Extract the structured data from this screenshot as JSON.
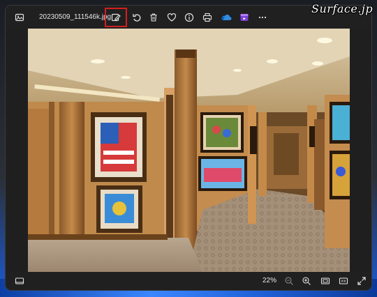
{
  "window": {
    "filename": "20230509_111546k.jpg"
  },
  "toolbar": {
    "items": [
      {
        "name": "gallery-icon"
      },
      {
        "name": "edit-image-icon",
        "highlighted": true
      },
      {
        "name": "rotate-icon"
      },
      {
        "name": "delete-icon"
      },
      {
        "name": "favorite-heart-icon"
      },
      {
        "name": "info-icon"
      },
      {
        "name": "print-icon"
      },
      {
        "name": "onedrive-icon"
      },
      {
        "name": "clipchamp-icon"
      },
      {
        "name": "more-options-icon"
      }
    ],
    "highlight_color": "#d21f1f"
  },
  "bottombar": {
    "zoom_level": "22%"
  },
  "watermark": {
    "text": "Surface.jp"
  }
}
